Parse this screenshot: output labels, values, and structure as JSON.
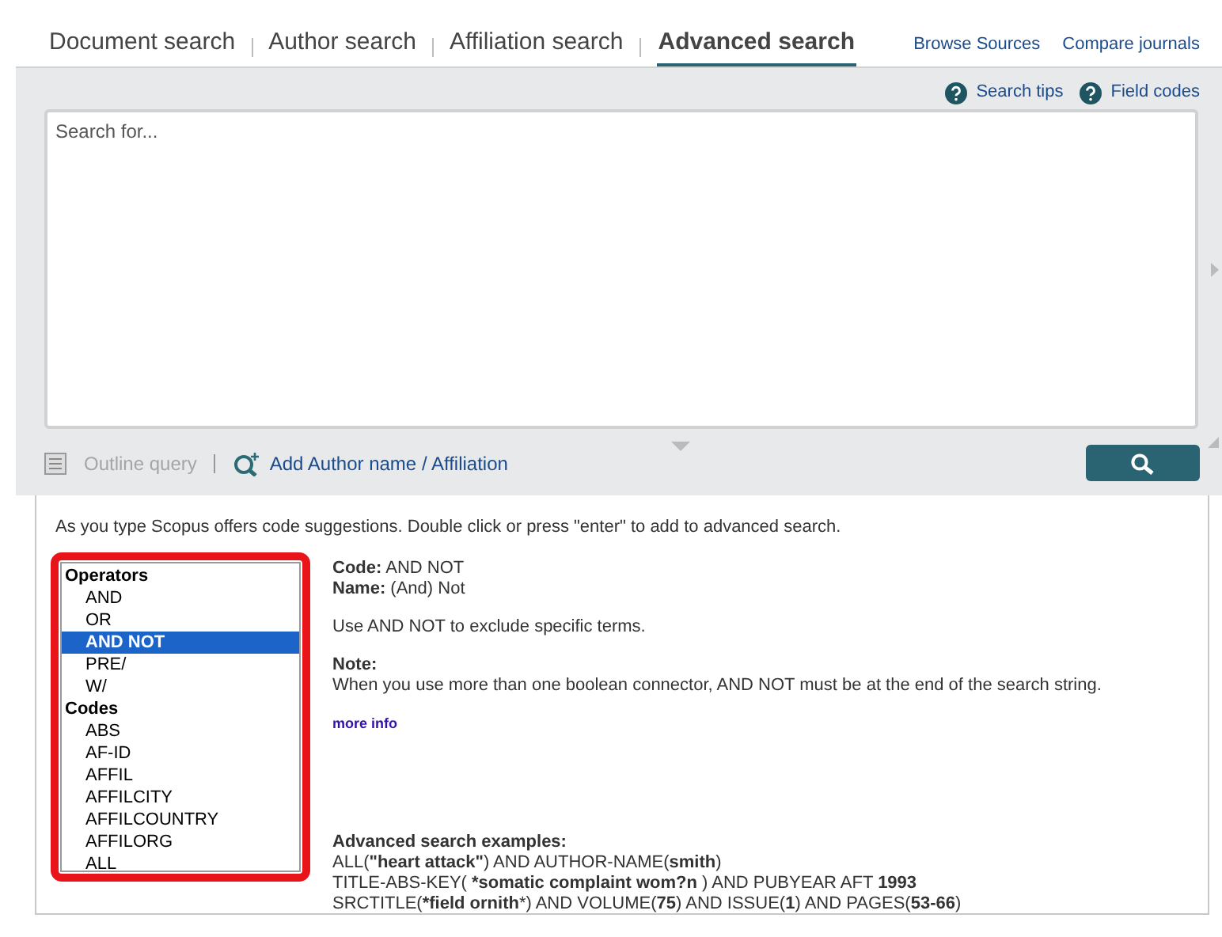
{
  "tabs": [
    {
      "label": "Document search",
      "selected": false
    },
    {
      "label": "Author search",
      "selected": false
    },
    {
      "label": "Affiliation search",
      "selected": false
    },
    {
      "label": "Advanced search",
      "selected": true
    }
  ],
  "top_links": [
    "Browse Sources",
    "Compare journals"
  ],
  "help_links": [
    "Search tips",
    "Field codes"
  ],
  "search": {
    "placeholder": "Search for..."
  },
  "outline_query": {
    "label": "Outline query",
    "disabled": true
  },
  "add_author": "Add Author name / Affiliation",
  "hint": "As you type Scopus offers code suggestions. Double click or press \"enter\" to add to advanced search.",
  "code_list": [
    {
      "kind": "group",
      "label": "Operators"
    },
    {
      "kind": "item",
      "label": "AND",
      "selected": false
    },
    {
      "kind": "item",
      "label": "OR",
      "selected": false
    },
    {
      "kind": "item",
      "label": "AND NOT",
      "selected": true
    },
    {
      "kind": "item",
      "label": "PRE/",
      "selected": false
    },
    {
      "kind": "item",
      "label": "W/",
      "selected": false
    },
    {
      "kind": "group",
      "label": "Codes"
    },
    {
      "kind": "item",
      "label": "ABS",
      "selected": false
    },
    {
      "kind": "item",
      "label": "AF-ID",
      "selected": false
    },
    {
      "kind": "item",
      "label": "AFFIL",
      "selected": false
    },
    {
      "kind": "item",
      "label": "AFFILCITY",
      "selected": false
    },
    {
      "kind": "item",
      "label": "AFFILCOUNTRY",
      "selected": false
    },
    {
      "kind": "item",
      "label": "AFFILORG",
      "selected": false
    },
    {
      "kind": "item",
      "label": "ALL",
      "selected": false
    }
  ],
  "details": {
    "code": "**Code:** AND NOT",
    "name": "**Name:** (And) Not",
    "description": "Use AND NOT to exclude specific terms.",
    "note_title": "Note:",
    "note": "When you use more than one boolean connector, AND NOT must be at the end of the search string.",
    "more_info": "more info",
    "examples_title": "Advanced search examples:",
    "examples": [
      "ALL(**\"heart attack\"**) AND AUTHOR-NAME(**smith**)",
      "TITLE-ABS-KEY( ***somatic complaint wom?n** ) AND PUBYEAR AFT **1993**",
      "SRCTITLE(***field ornith***) AND VOLUME(**75**) AND ISSUE(**1**) AND PAGES(**53-66**)"
    ]
  }
}
